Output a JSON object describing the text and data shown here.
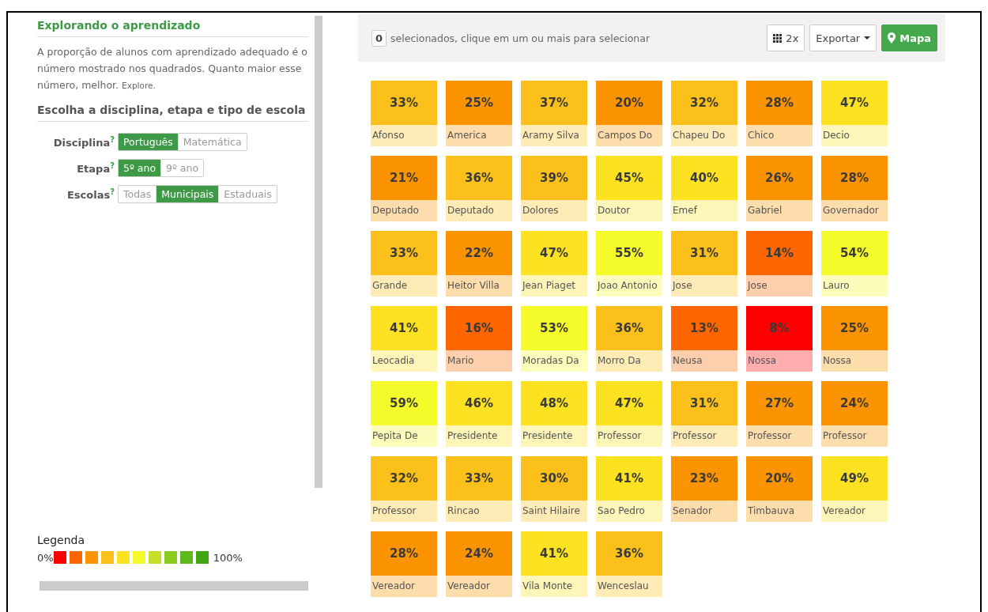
{
  "sidebar": {
    "title": "Explorando o aprendizado",
    "description": "A proporção de alunos com aprendizado adequado é o número mostrado nos quadrados. Quanto maior esse número, melhor.",
    "explore_link": "Explore.",
    "filter_heading": "Escolha a disciplina, etapa e tipo de escola",
    "filters": [
      {
        "label": "Disciplina",
        "help": "?",
        "options": [
          {
            "label": "Português",
            "selected": true
          },
          {
            "label": "Matemática",
            "selected": false
          }
        ]
      },
      {
        "label": "Etapa",
        "help": "?",
        "options": [
          {
            "label": "5º ano",
            "selected": true
          },
          {
            "label": "9º ano",
            "selected": false
          }
        ]
      },
      {
        "label": "Escolas",
        "help": "?",
        "options": [
          {
            "label": "Todas",
            "selected": false
          },
          {
            "label": "Municipais",
            "selected": true
          },
          {
            "label": "Estaduais",
            "selected": false
          }
        ]
      }
    ],
    "legend": {
      "title": "Legenda",
      "min_label": "0%",
      "max_label": "100%",
      "swatches": [
        {
          "color": "#ff0000"
        },
        {
          "color": "#ff6600"
        },
        {
          "color": "#fb9400"
        },
        {
          "color": "#fbc01a"
        },
        {
          "color": "#fce220"
        },
        {
          "color": "#f5fa2a"
        },
        {
          "color": "#c8df2a"
        },
        {
          "color": "#8bcb1e"
        },
        {
          "color": "#5fb81d"
        },
        {
          "color": "#3fa512"
        }
      ]
    }
  },
  "toolbar": {
    "selected_count": "0",
    "selected_hint": "selecionados, clique em um ou mais para selecionar",
    "grid_button": "2x",
    "export_button": "Exportar",
    "map_button": "Mapa"
  },
  "tiles": [
    {
      "value": "33%",
      "name": "Afonso",
      "color": "#fbc01a"
    },
    {
      "value": "25%",
      "name": "America",
      "color": "#fb9400"
    },
    {
      "value": "37%",
      "name": "Aramy Silva",
      "color": "#fbc01a"
    },
    {
      "value": "20%",
      "name": "Campos Do",
      "color": "#fb9400"
    },
    {
      "value": "32%",
      "name": "Chapeu Do",
      "color": "#fbc01a"
    },
    {
      "value": "28%",
      "name": "Chico",
      "color": "#fb9400"
    },
    {
      "value": "47%",
      "name": "Decio",
      "color": "#fce220"
    },
    {
      "value": "21%",
      "name": "Deputado",
      "color": "#fb9400"
    },
    {
      "value": "36%",
      "name": "Deputado",
      "color": "#fbc01a"
    },
    {
      "value": "39%",
      "name": "Dolores",
      "color": "#fbc01a"
    },
    {
      "value": "45%",
      "name": "Doutor",
      "color": "#fce220"
    },
    {
      "value": "40%",
      "name": "Emef",
      "color": "#fce220"
    },
    {
      "value": "26%",
      "name": "Gabriel",
      "color": "#fb9400"
    },
    {
      "value": "28%",
      "name": "Governador",
      "color": "#fb9400"
    },
    {
      "value": "33%",
      "name": "Grande",
      "color": "#fbc01a"
    },
    {
      "value": "22%",
      "name": "Heitor Villa",
      "color": "#fb9400"
    },
    {
      "value": "47%",
      "name": "Jean Piaget",
      "color": "#fce220"
    },
    {
      "value": "55%",
      "name": "Joao Antonio",
      "color": "#f5fa2a"
    },
    {
      "value": "31%",
      "name": "Jose",
      "color": "#fbc01a"
    },
    {
      "value": "14%",
      "name": "Jose",
      "color": "#ff6600"
    },
    {
      "value": "54%",
      "name": "Lauro",
      "color": "#f5fa2a"
    },
    {
      "value": "41%",
      "name": "Leocadia",
      "color": "#fce220"
    },
    {
      "value": "16%",
      "name": "Mario",
      "color": "#ff6600"
    },
    {
      "value": "53%",
      "name": "Moradas Da",
      "color": "#f5fa2a"
    },
    {
      "value": "36%",
      "name": "Morro Da",
      "color": "#fbc01a"
    },
    {
      "value": "13%",
      "name": "Neusa",
      "color": "#ff6600"
    },
    {
      "value": "8%",
      "name": "Nossa",
      "color": "#ff0000"
    },
    {
      "value": "25%",
      "name": "Nossa",
      "color": "#fb9400"
    },
    {
      "value": "59%",
      "name": "Pepita De",
      "color": "#f5fa2a"
    },
    {
      "value": "46%",
      "name": "Presidente",
      "color": "#fce220"
    },
    {
      "value": "48%",
      "name": "Presidente",
      "color": "#fce220"
    },
    {
      "value": "47%",
      "name": "Professor",
      "color": "#fce220"
    },
    {
      "value": "31%",
      "name": "Professor",
      "color": "#fbc01a"
    },
    {
      "value": "27%",
      "name": "Professor",
      "color": "#fb9400"
    },
    {
      "value": "24%",
      "name": "Professor",
      "color": "#fb9400"
    },
    {
      "value": "32%",
      "name": "Professor",
      "color": "#fbc01a"
    },
    {
      "value": "33%",
      "name": "Rincao",
      "color": "#fbc01a"
    },
    {
      "value": "30%",
      "name": "Saint Hilaire",
      "color": "#fbc01a"
    },
    {
      "value": "41%",
      "name": "Sao Pedro",
      "color": "#fce220"
    },
    {
      "value": "23%",
      "name": "Senador",
      "color": "#fb9400"
    },
    {
      "value": "20%",
      "name": "Timbauva",
      "color": "#fb9400"
    },
    {
      "value": "49%",
      "name": "Vereador",
      "color": "#fce220"
    },
    {
      "value": "28%",
      "name": "Vereador",
      "color": "#fb9400"
    },
    {
      "value": "24%",
      "name": "Vereador",
      "color": "#fb9400"
    },
    {
      "value": "41%",
      "name": "Vila Monte",
      "color": "#fce220"
    },
    {
      "value": "36%",
      "name": "Wenceslau",
      "color": "#fbc01a"
    }
  ]
}
